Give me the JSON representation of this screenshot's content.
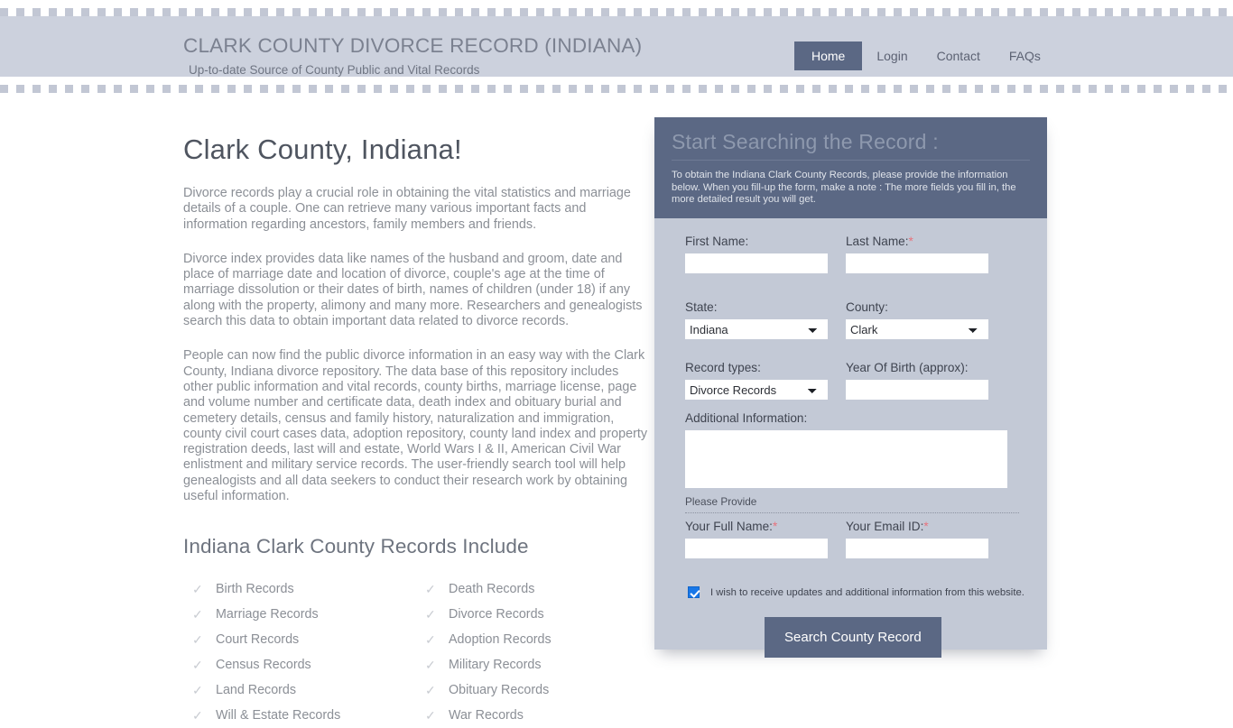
{
  "header": {
    "title": "CLARK COUNTY DIVORCE RECORD (INDIANA)",
    "tagline": "Up-to-date Source of  County Public and Vital Records",
    "nav": [
      {
        "label": "Home",
        "active": true
      },
      {
        "label": "Login",
        "active": false
      },
      {
        "label": "Contact",
        "active": false
      },
      {
        "label": "FAQs",
        "active": false
      }
    ]
  },
  "main": {
    "heading": "Clark County, Indiana!",
    "paragraphs": [
      "Divorce records play a crucial role in obtaining the vital statistics and marriage details of a couple. One can retrieve many various important facts and information regarding ancestors, family members and friends.",
      "Divorce index provides data like names of the husband and groom, date and place of marriage date and location of divorce, couple's age at the time of marriage dissolution or their dates of birth, names of children (under 18) if any along with the property, alimony and many more. Researchers and genealogists search this data to obtain important data related to divorce records.",
      "People can now find the public divorce information in an easy way with the Clark County, Indiana divorce repository. The data base of this repository includes other public information and vital records, county births, marriage license, page and volume number and certificate data, death index and obituary burial and cemetery details, census and family history, naturalization and immigration, county civil court cases data, adoption repository, county land index and property registration deeds, last will and estate, World Wars I & II, American Civil War enlistment and military service records. The user-friendly search tool will help genealogists and all data seekers to conduct their research work by obtaining useful information."
    ],
    "records_heading": "Indiana Clark County Records Include",
    "records_left": [
      "Birth Records",
      "Marriage Records",
      "Court Records",
      "Census Records",
      "Land Records",
      "Will & Estate Records"
    ],
    "records_right": [
      "Death Records",
      "Divorce Records",
      "Adoption Records",
      "Military Records",
      "Obituary Records",
      "War Records"
    ],
    "check_glyph": "✓"
  },
  "form": {
    "panel_title": "Start Searching the Record :",
    "panel_subtitle": "To obtain the Indiana Clark County Records, please provide the information below. When you fill-up the form, make a note : The more fields you fill in, the more detailed result you will get.",
    "first_name_label": "First Name:",
    "first_name_value": "",
    "last_name_label": "Last Name:",
    "last_name_required": "*",
    "last_name_value": "",
    "state_label": "State:",
    "state_value": "Indiana",
    "county_label": "County:",
    "county_value": "Clark",
    "record_types_label": "Record types:",
    "record_types_value": "Divorce Records",
    "year_label": "Year Of Birth (approx):",
    "year_value": "",
    "additional_label": "Additional Information:",
    "additional_value": "",
    "please_provide": "Please Provide",
    "full_name_label": "Your Full Name:",
    "full_name_required": "*",
    "full_name_value": "",
    "email_label": "Your Email ID:",
    "email_required": "*",
    "email_value": "",
    "consent_text": "I wish to receive updates and additional information from this website.",
    "consent_checked": true,
    "submit_label": "Search County Record",
    "accent_color": "#5b6884",
    "panel_body_color": "#c3c9d6",
    "required_color": "#e8727c",
    "checkbox_color": "#1877e8"
  }
}
